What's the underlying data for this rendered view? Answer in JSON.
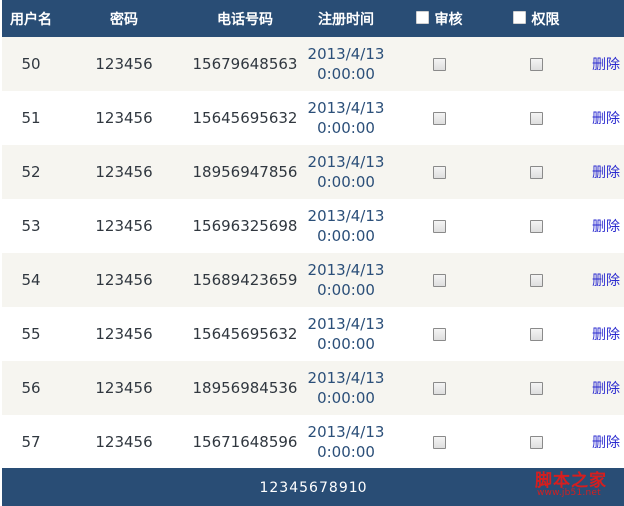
{
  "header": {
    "username": "用户名",
    "password": "密码",
    "phone": "电话号码",
    "registered": "注册时间",
    "review": "审核",
    "permission": "权限"
  },
  "rows": [
    {
      "username": "50",
      "password": "123456",
      "phone": "15679648563",
      "date": "2013/4/13",
      "time": "0:00:00",
      "review_checked": false,
      "permission_checked": false,
      "action": "删除"
    },
    {
      "username": "51",
      "password": "123456",
      "phone": "15645695632",
      "date": "2013/4/13",
      "time": "0:00:00",
      "review_checked": false,
      "permission_checked": false,
      "action": "删除"
    },
    {
      "username": "52",
      "password": "123456",
      "phone": "18956947856",
      "date": "2013/4/13",
      "time": "0:00:00",
      "review_checked": false,
      "permission_checked": false,
      "action": "删除"
    },
    {
      "username": "53",
      "password": "123456",
      "phone": "15696325698",
      "date": "2013/4/13",
      "time": "0:00:00",
      "review_checked": false,
      "permission_checked": false,
      "action": "删除"
    },
    {
      "username": "54",
      "password": "123456",
      "phone": "15689423659",
      "date": "2013/4/13",
      "time": "0:00:00",
      "review_checked": false,
      "permission_checked": false,
      "action": "删除"
    },
    {
      "username": "55",
      "password": "123456",
      "phone": "15645695632",
      "date": "2013/4/13",
      "time": "0:00:00",
      "review_checked": false,
      "permission_checked": false,
      "action": "删除"
    },
    {
      "username": "56",
      "password": "123456",
      "phone": "18956984536",
      "date": "2013/4/13",
      "time": "0:00:00",
      "review_checked": false,
      "permission_checked": false,
      "action": "删除"
    },
    {
      "username": "57",
      "password": "123456",
      "phone": "15671648596",
      "date": "2013/4/13",
      "time": "0:00:00",
      "review_checked": false,
      "permission_checked": false,
      "action": "删除"
    }
  ],
  "pager": {
    "pages": [
      "1",
      "2",
      "3",
      "4",
      "5",
      "6",
      "7",
      "8",
      "9",
      "10"
    ]
  },
  "watermark": {
    "title": "脚本之家",
    "url": "www.jb51.net"
  },
  "colors": {
    "header_bg": "#294d75",
    "row_alt_bg": "#f6f5f0",
    "link": "#2b2bcf",
    "watermark": "#d61e1e"
  }
}
